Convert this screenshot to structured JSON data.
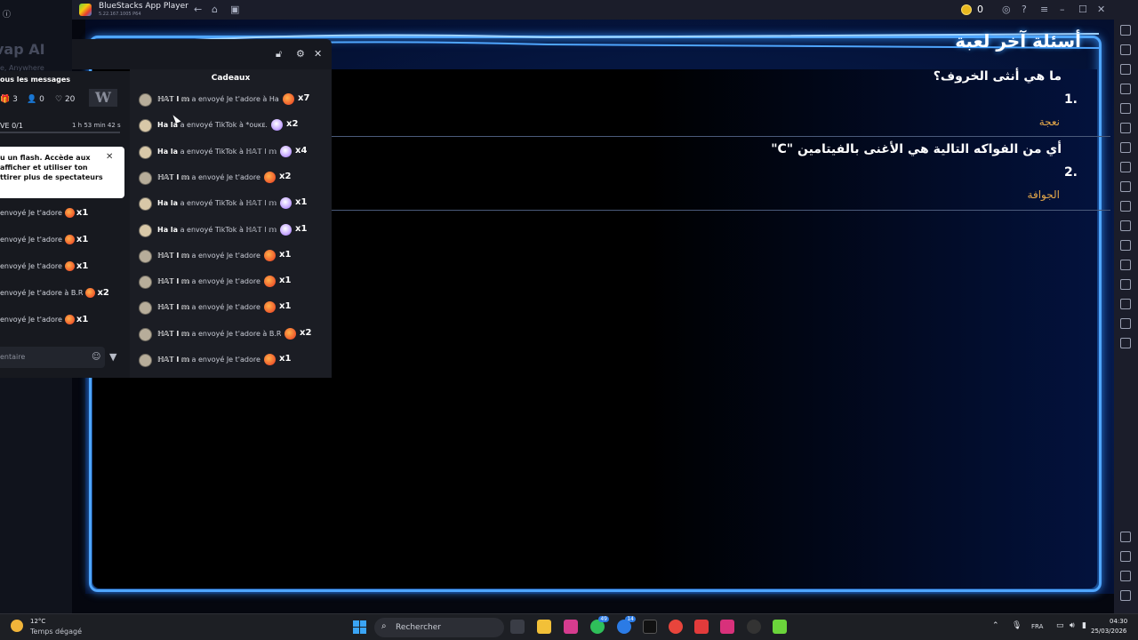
{
  "titlebar": {
    "app_title": "BlueStacks App Player",
    "version": "5.22.167.1005 P64",
    "coin_count": "0"
  },
  "left_panel": {
    "top_icon": "info-icon",
    "swap_title": "vap AI",
    "swap_sub": "e, Anywhere",
    "messages_header": "ous les messages",
    "stats": {
      "gifts": "3",
      "follows": "0",
      "likes": "20"
    },
    "goal": "VE 0/1",
    "goal_progress": 0,
    "timer": "1 h 53 min 42 s",
    "flash_text": "u un flash. Accède aux afficher et utiliser ton ttirer plus de spectateurs",
    "recent_gifts": [
      {
        "text": "envoyé Je t'adore",
        "mult": "x1"
      },
      {
        "text": "envoyé Je t'adore",
        "mult": "x1"
      },
      {
        "text": "envoyé Je t'adore",
        "mult": "x1"
      },
      {
        "text": "envoyé Je t'adore à B.R",
        "mult": "x2"
      },
      {
        "text": "envoyé Je t'adore",
        "mult": "x1"
      }
    ],
    "comment_placeholder": "entaire"
  },
  "gifts_panel": {
    "title": "Cadeaux",
    "rows": [
      {
        "name": "ℍ𝔸𝕋 l 𝕞",
        "text": "a envoyé Je t'adore à Ha",
        "gift": "heart",
        "mult": "x7"
      },
      {
        "name": "Ha la",
        "text": "a envoyé TikTok à *ᴏᴜᴋᴇ.",
        "gift": "tiktok",
        "mult": "x2"
      },
      {
        "name": "Ha la",
        "text": "a envoyé TikTok à ℍ𝔸𝕋 l 𝕞",
        "gift": "tiktok",
        "mult": "x4"
      },
      {
        "name": "ℍ𝔸𝕋 l 𝕞",
        "text": "a envoyé Je t'adore",
        "gift": "heart",
        "mult": "x2"
      },
      {
        "name": "Ha la",
        "text": "a envoyé TikTok à ℍ𝔸𝕋 l 𝕞",
        "gift": "tiktok",
        "mult": "x1"
      },
      {
        "name": "Ha la",
        "text": "a envoyé TikTok à ℍ𝔸𝕋 l 𝕞",
        "gift": "tiktok",
        "mult": "x1"
      },
      {
        "name": "ℍ𝔸𝕋 l 𝕞",
        "text": "a envoyé Je t'adore",
        "gift": "heart",
        "mult": "x1"
      },
      {
        "name": "ℍ𝔸𝕋 l 𝕞",
        "text": "a envoyé Je t'adore",
        "gift": "heart",
        "mult": "x1"
      },
      {
        "name": "ℍ𝔸𝕋 l 𝕞",
        "text": "a envoyé Je t'adore",
        "gift": "heart",
        "mult": "x1"
      },
      {
        "name": "ℍ𝔸𝕋 l 𝕞",
        "text": "a envoyé Je t'adore à B.R",
        "gift": "heart",
        "mult": "x2"
      },
      {
        "name": "ℍ𝔸𝕋 l 𝕞",
        "text": "a envoyé Je t'adore",
        "gift": "heart",
        "mult": "x1"
      }
    ]
  },
  "game": {
    "title": "أسئلة آخر لعبة",
    "questions": [
      {
        "number": "1.",
        "question": "ما هي أنثى الخروف؟",
        "answer": "نعجة"
      },
      {
        "number": "2.",
        "question": "أي من الفواكه التالية هي الأغنى بالفيتامين \"C\"",
        "answer": "الجوافة"
      }
    ]
  },
  "taskbar": {
    "temp": "12°C",
    "weather": "Temps dégagé",
    "search_placeholder": "Rechercher",
    "badge_whatsapp": "49",
    "badge_messenger": "14",
    "language": "FRA",
    "time": "04:30",
    "date": "25/03/2026"
  },
  "colors": {
    "accent": "#4fa6ff",
    "answer": "#e3a64a",
    "windows_blue": "#3aa4f5"
  }
}
